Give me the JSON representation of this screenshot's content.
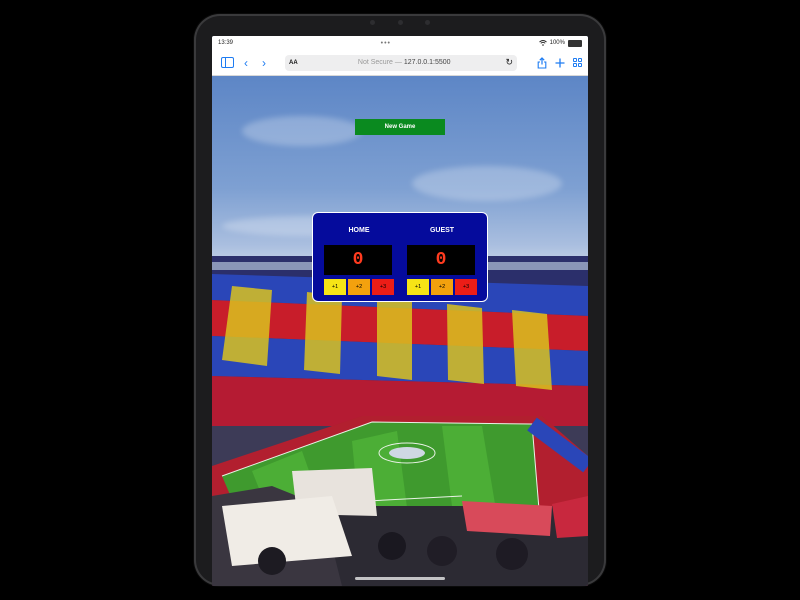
{
  "status_bar": {
    "time": "13:39",
    "dots": "•••",
    "battery": "100%"
  },
  "browser": {
    "aa_label": "AA",
    "url_prefix": "Not Secure —",
    "url": "127.0.0.1:5500"
  },
  "app": {
    "new_game_label": "New Game",
    "home": {
      "label": "HOME",
      "score": "0"
    },
    "guest": {
      "label": "GUEST",
      "score": "0"
    },
    "buttons": {
      "plus1": "+1",
      "plus2": "+2",
      "plus3": "+3"
    }
  },
  "colors": {
    "scoreboard_bg": "#050b9c",
    "score_text": "#ff3b1f",
    "new_game_bg": "#0a8a1f",
    "plus1_bg": "#f6e416",
    "plus2_bg": "#f3a10e",
    "plus3_bg": "#ec1d17",
    "browser_accent": "#1e7cf2"
  },
  "icons": {
    "sidebar": "sidebar-icon",
    "back": "chevron-left-icon",
    "forward": "chevron-right-icon",
    "reload": "reload-icon",
    "share": "share-icon",
    "new_tab": "plus-icon",
    "tabs": "tabs-grid-icon",
    "wifi": "wifi-icon",
    "battery": "battery-icon"
  }
}
